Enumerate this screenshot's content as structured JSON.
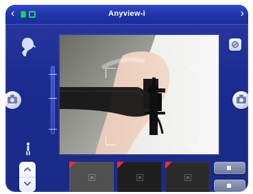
{
  "header": {
    "title": "Anyview-i"
  },
  "left_controls": {
    "scale_ticks": [
      {
        "label": ""
      },
      {
        "label": ""
      },
      {
        "label": ""
      }
    ],
    "scale_bottom_label": ""
  },
  "thumbnails": {
    "items": [
      {
        "flag_color": "#ff2a2a"
      },
      {
        "flag_color": "#ff2a2a"
      },
      {
        "flag_color": "#ff2a2a"
      }
    ]
  },
  "right_actions": {
    "top_button_label": "",
    "bottom_button_label": ""
  },
  "theme": {
    "device_bg": "#1b2b8f",
    "header_bg": "#2034a8",
    "status_green": "#17d36b"
  }
}
